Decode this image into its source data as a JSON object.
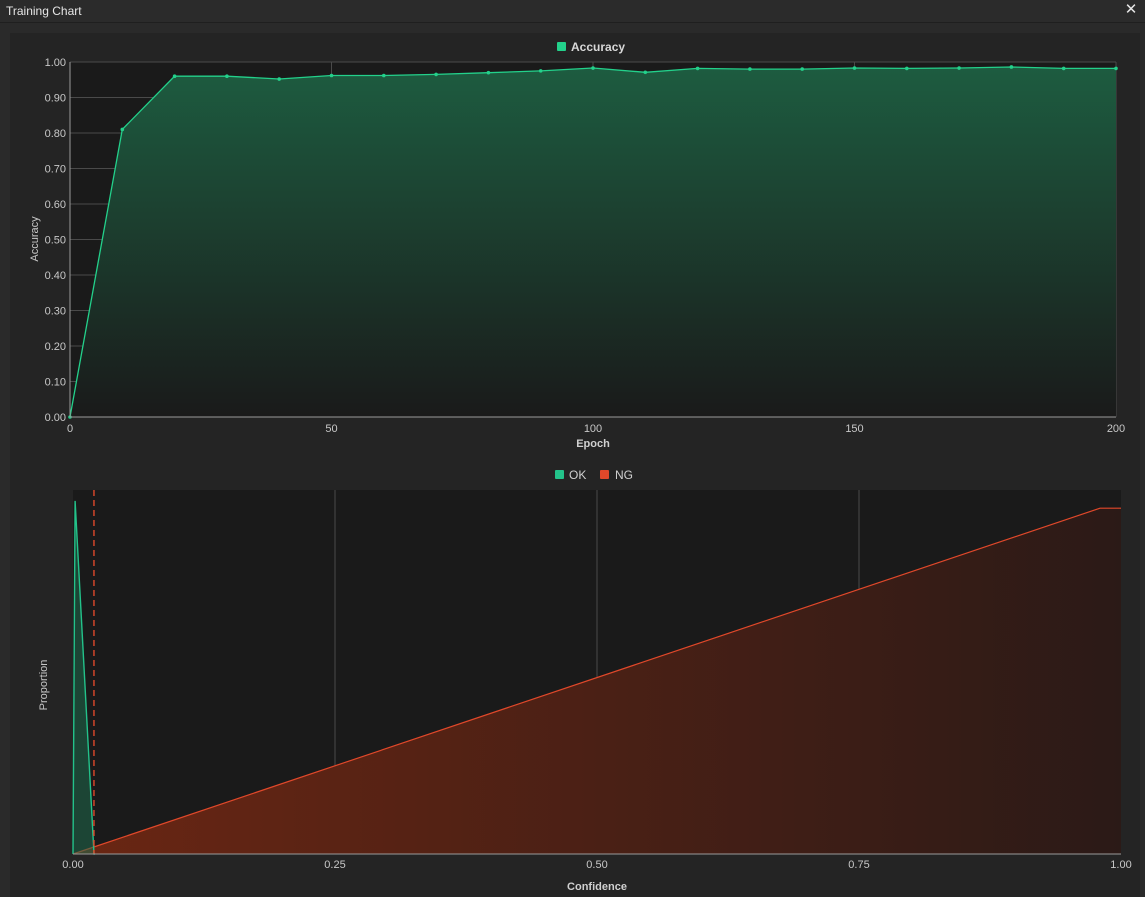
{
  "window": {
    "title": "Training Chart",
    "close_icon": "close-icon"
  },
  "colors": {
    "accuracy": "#23d18b",
    "ok": "#23c28a",
    "ng": "#e0482a",
    "plot_bg": "#1a1a1a",
    "grid": "#4a4a4a"
  },
  "chart_data": [
    {
      "type": "area",
      "title": "",
      "xlabel": "Epoch",
      "ylabel": "Accuracy",
      "legend": {
        "placement": "top-center",
        "entries": [
          "Accuracy"
        ]
      },
      "grid": true,
      "xlim": [
        0,
        200
      ],
      "ylim": [
        0,
        1
      ],
      "x_ticks": [
        "0",
        "50",
        "100",
        "150",
        "200"
      ],
      "y_ticks": [
        "0.00",
        "0.10",
        "0.20",
        "0.30",
        "0.40",
        "0.50",
        "0.60",
        "0.70",
        "0.80",
        "0.90",
        "1.00"
      ],
      "series": [
        {
          "name": "Accuracy",
          "x": [
            0,
            10,
            20,
            30,
            40,
            50,
            60,
            70,
            80,
            90,
            100,
            110,
            120,
            130,
            140,
            150,
            160,
            170,
            180,
            190,
            200
          ],
          "y": [
            0.0,
            0.81,
            0.96,
            0.96,
            0.952,
            0.962,
            0.962,
            0.965,
            0.97,
            0.975,
            0.983,
            0.971,
            0.982,
            0.98,
            0.98,
            0.983,
            0.982,
            0.983,
            0.986,
            0.982,
            0.982
          ]
        }
      ]
    },
    {
      "type": "area",
      "title": "",
      "xlabel": "Confidence",
      "ylabel": "Proportion",
      "legend": {
        "placement": "top-center",
        "entries": [
          "OK",
          "NG"
        ]
      },
      "grid": true,
      "xlim": [
        0,
        1
      ],
      "ylim": [
        0,
        1
      ],
      "x_ticks": [
        "0.00",
        "0.25",
        "0.50",
        "0.75",
        "1.00"
      ],
      "threshold": 0.02,
      "series": [
        {
          "name": "OK",
          "x": [
            0.0,
            0.002,
            0.02,
            0.021
          ],
          "y": [
            0.0,
            0.97,
            0.0,
            0.0
          ]
        },
        {
          "name": "NG",
          "x": [
            0.0,
            0.98,
            1.0
          ],
          "y": [
            0.0,
            0.95,
            0.95
          ]
        }
      ]
    }
  ]
}
